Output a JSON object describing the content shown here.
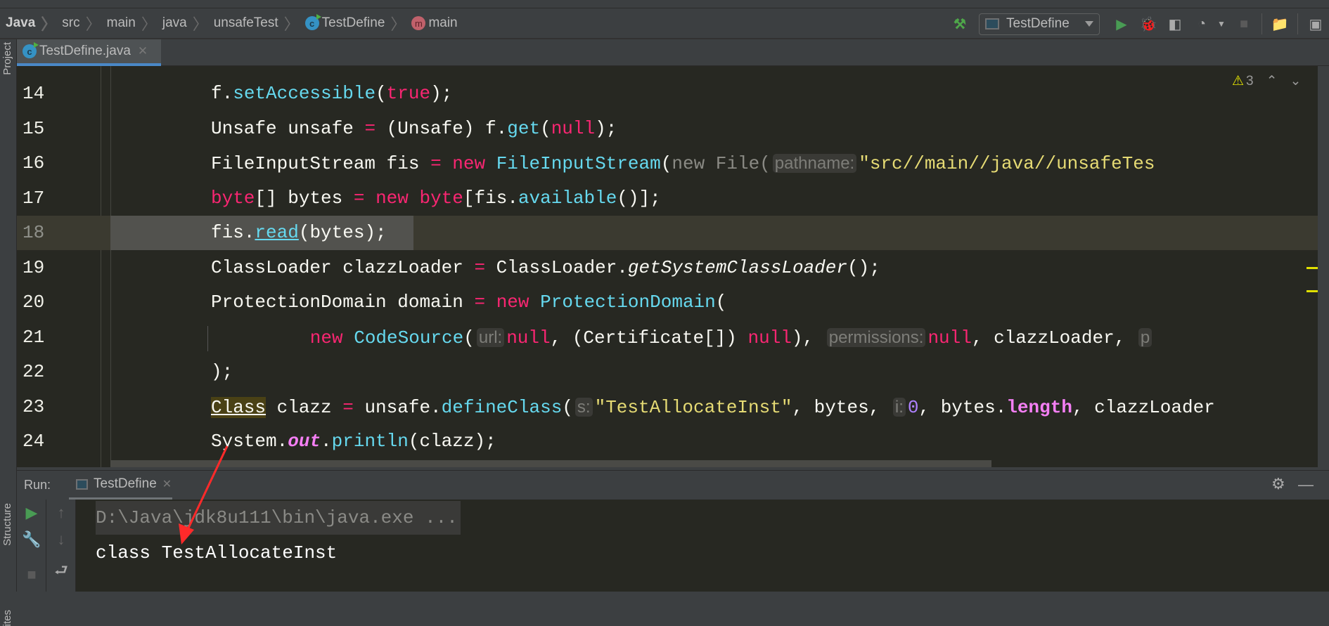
{
  "breadcrumb": [
    {
      "label": "Java",
      "icon": null
    },
    {
      "label": "src",
      "icon": null
    },
    {
      "label": "main",
      "icon": null
    },
    {
      "label": "java",
      "icon": null
    },
    {
      "label": "unsafeTest",
      "icon": null
    },
    {
      "label": "TestDefine",
      "icon": "class-icon",
      "icon_glyph": "c"
    },
    {
      "label": "main",
      "icon": "method-icon",
      "icon_glyph": "m"
    }
  ],
  "toolbar": {
    "run_config": "TestDefine",
    "build_icon": "hammer-icon",
    "run_icon": "play-icon",
    "debug_icon": "bug-icon",
    "coverage_icon": "coverage-icon",
    "profile_icon": "profile-icon",
    "stop_icon": "stop-icon",
    "project_structure_icon": "project-structure-icon",
    "terminal_icon": "terminal-icon"
  },
  "left_strip": {
    "project": "Project",
    "structure": "Structure",
    "favorites": "ites"
  },
  "editor": {
    "tab": "TestDefine.java",
    "warnings_count": "3",
    "current_line": 18,
    "lines": [
      {
        "n": "14",
        "indent": 0,
        "tokens": [
          [
            "f.",
            ""
          ],
          [
            "setAccessible",
            "fn"
          ],
          [
            "(",
            ""
          ],
          [
            "true",
            "kw"
          ],
          [
            ");",
            ""
          ]
        ]
      },
      {
        "n": "15",
        "indent": 0,
        "tokens": [
          [
            "Unsafe unsafe ",
            ""
          ],
          [
            "=",
            "kw"
          ],
          [
            " (Unsafe) f.",
            ""
          ],
          [
            "get",
            "fn"
          ],
          [
            "(",
            ""
          ],
          [
            "null",
            "kw"
          ],
          [
            ");",
            ""
          ]
        ]
      },
      {
        "n": "16",
        "indent": 0,
        "tokens": [
          [
            "FileInputStream fis ",
            ""
          ],
          [
            "=",
            "kw"
          ],
          [
            " ",
            ""
          ],
          [
            "new",
            "kw"
          ],
          [
            " ",
            ""
          ],
          [
            "FileInputStream",
            "fn"
          ],
          [
            "(",
            ""
          ],
          [
            "new File(",
            "dim"
          ],
          [
            "pathname:",
            "hint"
          ],
          [
            "\"src//main//java//unsafeTes",
            "str"
          ]
        ]
      },
      {
        "n": "17",
        "indent": 0,
        "tokens": [
          [
            "byte",
            "kw"
          ],
          [
            "[] bytes ",
            ""
          ],
          [
            "=",
            "kw"
          ],
          [
            " ",
            ""
          ],
          [
            "new",
            "kw"
          ],
          [
            " ",
            ""
          ],
          [
            "byte",
            "kw"
          ],
          [
            "[fis.",
            ""
          ],
          [
            "available",
            "fn"
          ],
          [
            "()];",
            ""
          ]
        ]
      },
      {
        "n": "18",
        "indent": 0,
        "tokens": [
          [
            "fis.",
            ""
          ],
          [
            "read",
            "fn under"
          ],
          [
            "(bytes);",
            ""
          ]
        ]
      },
      {
        "n": "19",
        "indent": 0,
        "tokens": [
          [
            "ClassLoader clazzLoader ",
            ""
          ],
          [
            "=",
            "kw"
          ],
          [
            " ClassLoader.",
            ""
          ],
          [
            "getSystemClassLoader",
            "italic"
          ],
          [
            "();",
            ""
          ]
        ]
      },
      {
        "n": "20",
        "indent": 0,
        "tokens": [
          [
            "ProtectionDomain domain ",
            ""
          ],
          [
            "=",
            "kw"
          ],
          [
            " ",
            ""
          ],
          [
            "new",
            "kw"
          ],
          [
            " ",
            ""
          ],
          [
            "ProtectionDomain",
            "fn"
          ],
          [
            "(",
            ""
          ]
        ]
      },
      {
        "n": "21",
        "indent": 11,
        "tokens": [
          [
            "new",
            "kw"
          ],
          [
            " ",
            ""
          ],
          [
            "CodeSource",
            "fn"
          ],
          [
            "(",
            ""
          ],
          [
            "url:",
            "hint"
          ],
          [
            "null",
            "kw"
          ],
          [
            ", (Certificate[]) ",
            ""
          ],
          [
            "null",
            "kw"
          ],
          [
            "), ",
            ""
          ],
          [
            "permissions:",
            "hint"
          ],
          [
            "null",
            "kw"
          ],
          [
            ", clazzLoader, ",
            ""
          ],
          [
            "p",
            "hint"
          ]
        ]
      },
      {
        "n": "22",
        "indent": 0,
        "tokens": [
          [
            ");",
            ""
          ]
        ]
      },
      {
        "n": "23",
        "indent": 0,
        "tokens": [
          [
            "Class",
            "mark"
          ],
          [
            " clazz ",
            ""
          ],
          [
            "=",
            "kw"
          ],
          [
            " unsafe.",
            ""
          ],
          [
            "defineClass",
            "fn"
          ],
          [
            "(",
            ""
          ],
          [
            "s:",
            "hint"
          ],
          [
            "\"TestAllocateInst\"",
            "str"
          ],
          [
            ", bytes, ",
            ""
          ],
          [
            "i:",
            "hint"
          ],
          [
            "0",
            "num"
          ],
          [
            ", bytes.",
            ""
          ],
          [
            "length",
            "field"
          ],
          [
            ", clazzLoader",
            ""
          ]
        ]
      },
      {
        "n": "24",
        "indent": 0,
        "tokens": [
          [
            "System.",
            ""
          ],
          [
            "out",
            "static"
          ],
          [
            ".",
            ""
          ],
          [
            "println",
            "fn"
          ],
          [
            "(clazz);",
            ""
          ]
        ]
      }
    ]
  },
  "run_panel": {
    "label": "Run:",
    "tab": "TestDefine",
    "command_line": "D:\\Java\\jdk8u111\\bin\\java.exe ...",
    "output": "class TestAllocateInst"
  },
  "colors": {
    "editor_bg": "#272822",
    "keyword": "#f92672",
    "function": "#66d9ef",
    "string": "#e6db74",
    "number": "#ae81ff",
    "annotation_arrow": "#ff2a2a",
    "accent": "#4a88c7"
  }
}
